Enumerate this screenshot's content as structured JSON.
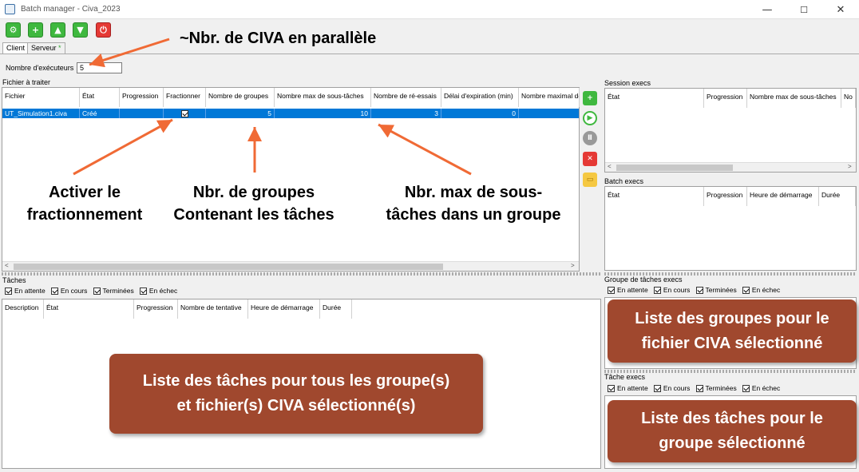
{
  "window": {
    "title": "Batch manager - Civa_2023",
    "minimize": "—",
    "maximize": "☐",
    "close": "✕"
  },
  "toolbar": {
    "icons": [
      "settings-icon",
      "add-icon",
      "upload-icon",
      "download-icon",
      "power-icon"
    ],
    "glyphs": [
      "⚙",
      "+",
      "▲",
      "▼",
      "⏻"
    ]
  },
  "tabs": [
    {
      "label": "Client"
    },
    {
      "label": "Serveur",
      "marker": "*"
    }
  ],
  "executors": {
    "label": "Nombre d'exécuteurs",
    "value": "5"
  },
  "files": {
    "title": "Fichier à traiter",
    "columns": [
      "Fichier",
      "État",
      "Progression",
      "Fractionner",
      "Nombre de groupes",
      "Nombre max de sous-tâches",
      "Nombre de ré-essais",
      "Délai d'expiration (min)",
      "Nombre maximal de"
    ],
    "rows": [
      {
        "fichier": "UT_Simulation1.civa",
        "etat": "Créé",
        "progression": "",
        "fractionner": true,
        "groupes": "5",
        "max_sous_taches": "10",
        "reessais": "3",
        "delai": "0"
      }
    ]
  },
  "tasks": {
    "title": "Tâches",
    "filters": [
      "En attente",
      "En cours",
      "Terminées",
      "En échec"
    ],
    "columns": [
      "Description",
      "État",
      "Progression",
      "Nombre de tentative",
      "Heure de démarrage",
      "Durée"
    ]
  },
  "session": {
    "title": "Session execs",
    "columns": [
      "État",
      "Progression",
      "Nombre max de sous-tâches",
      "No"
    ]
  },
  "batch": {
    "title": "Batch execs",
    "columns": [
      "État",
      "Progression",
      "Heure de démarrage",
      "Durée"
    ]
  },
  "groups": {
    "title": "Groupe de tâches execs",
    "filters": [
      "En attente",
      "En cours",
      "Terminées",
      "En échec"
    ]
  },
  "task_execs": {
    "title": "Tâche execs",
    "filters": [
      "En attente",
      "En cours",
      "Terminées",
      "En échec"
    ]
  },
  "annotations": {
    "parallel": "~Nbr. de CIVA en parallèle",
    "split": [
      "Activer le",
      "fractionnement"
    ],
    "groups": [
      "Nbr. de groupes",
      "Contenant les tâches"
    ],
    "max": [
      "Nbr. max de sous-",
      "tâches dans un groupe"
    ]
  },
  "callouts": {
    "tasks_all": [
      "Liste des tâches pour tous les groupe(s)",
      "et fichier(s) CIVA sélectionné(s)"
    ],
    "groups": [
      "Liste des groupes pour le",
      "fichier CIVA sélectionné"
    ],
    "tasks_group": [
      "Liste des tâches pour le",
      "groupe sélectionné"
    ]
  },
  "colors": {
    "accent": "#0078d7",
    "annotation_arrow": "#f06a35",
    "callout": "#a0482e"
  }
}
